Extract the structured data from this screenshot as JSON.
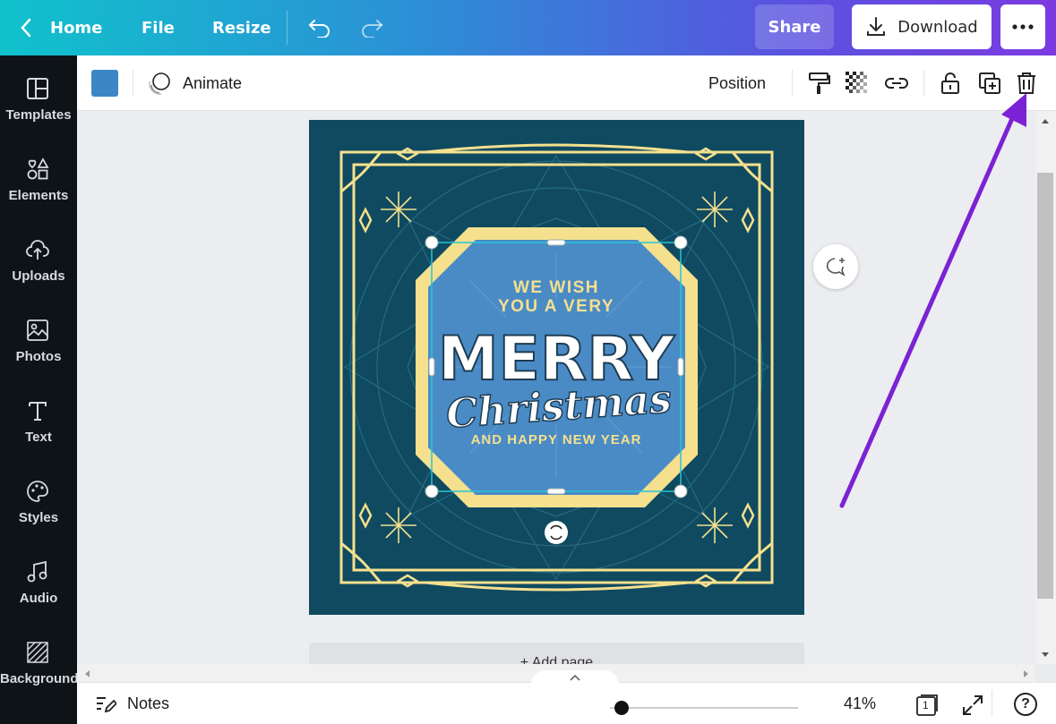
{
  "topbar": {
    "home_label": "Home",
    "file_label": "File",
    "resize_label": "Resize",
    "share_label": "Share",
    "download_label": "Download",
    "gradient": [
      "#10c2cc",
      "#7b3ae0"
    ]
  },
  "sidebar": {
    "items": [
      {
        "label": "Templates",
        "icon": "templates-icon"
      },
      {
        "label": "Elements",
        "icon": "elements-icon"
      },
      {
        "label": "Uploads",
        "icon": "uploads-icon"
      },
      {
        "label": "Photos",
        "icon": "photos-icon"
      },
      {
        "label": "Text",
        "icon": "text-icon"
      },
      {
        "label": "Styles",
        "icon": "styles-icon"
      },
      {
        "label": "Audio",
        "icon": "audio-icon"
      },
      {
        "label": "Background",
        "icon": "background-icon"
      }
    ]
  },
  "toolbar": {
    "swatch_color": "#3d86c6",
    "animate_label": "Animate",
    "position_label": "Position"
  },
  "design": {
    "line1": "WE WISH",
    "line2": "YOU A VERY",
    "line3": "MERRY",
    "line4": "Christmas",
    "line5": "AND HAPPY NEW YEAR",
    "bg_color": "#0f4a60",
    "center_color": "#4a8bc6",
    "gold_color": "#f5e08e"
  },
  "canvas": {
    "add_page_label": "+ Add page"
  },
  "bottombar": {
    "notes_label": "Notes",
    "zoom_label": "41%",
    "page_count": "1",
    "help_label": "?"
  },
  "annotation": {
    "arrow_color": "#7b22d4"
  }
}
